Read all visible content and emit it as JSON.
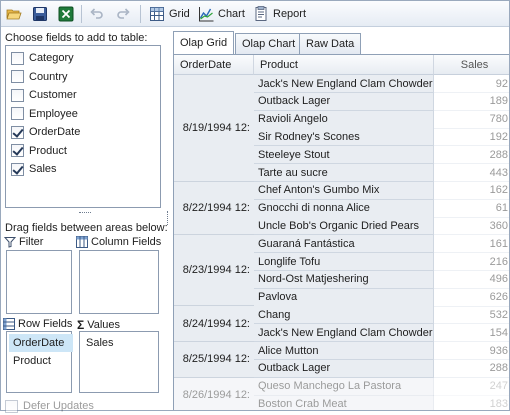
{
  "toolbar": {
    "grid_label": "Grid",
    "chart_label": "Chart",
    "report_label": "Report",
    "icons": [
      "open-folder-icon",
      "save-icon",
      "excel-icon",
      "undo-icon",
      "redo-icon",
      "grid-icon",
      "chart-icon",
      "report-icon"
    ]
  },
  "field_chooser": {
    "title": "Choose fields to add to table:",
    "fields": [
      {
        "label": "Category",
        "checked": false
      },
      {
        "label": "Country",
        "checked": false
      },
      {
        "label": "Customer",
        "checked": false
      },
      {
        "label": "Employee",
        "checked": false
      },
      {
        "label": "OrderDate",
        "checked": true
      },
      {
        "label": "Product",
        "checked": true
      },
      {
        "label": "Sales",
        "checked": true
      }
    ],
    "drag_hint": "Drag fields between areas below:",
    "areas": {
      "filter": {
        "label": "Filter",
        "items": []
      },
      "columns": {
        "label": "Column Fields",
        "items": []
      },
      "rows": {
        "label": "Row Fields",
        "items": [
          "OrderDate",
          "Product"
        ]
      },
      "values": {
        "label": "Values",
        "items": [
          "Sales"
        ]
      }
    },
    "defer_label": "Defer Updates"
  },
  "tabs": [
    "Olap Grid",
    "Olap Chart",
    "Raw Data"
  ],
  "grid": {
    "headers": [
      "OrderDate",
      "Product",
      "Sales"
    ],
    "groups": [
      {
        "date": "8/19/1994 12:",
        "rows": [
          {
            "product": "Jack's New England Clam Chowder",
            "sales": "92"
          },
          {
            "product": "Outback Lager",
            "sales": "189"
          },
          {
            "product": "Ravioli Angelo",
            "sales": "780"
          },
          {
            "product": "Sir Rodney's Scones",
            "sales": "192"
          },
          {
            "product": "Steeleye Stout",
            "sales": "288"
          },
          {
            "product": "Tarte au sucre",
            "sales": "443"
          }
        ]
      },
      {
        "date": "8/22/1994 12:",
        "rows": [
          {
            "product": "Chef Anton's Gumbo Mix",
            "sales": "162"
          },
          {
            "product": "Gnocchi di nonna Alice",
            "sales": "61"
          },
          {
            "product": "Uncle Bob's Organic Dried Pears",
            "sales": "360"
          }
        ]
      },
      {
        "date": "8/23/1994 12:",
        "rows": [
          {
            "product": "Guaraná Fantástica",
            "sales": "161"
          },
          {
            "product": "Longlife Tofu",
            "sales": "216"
          },
          {
            "product": "Nord-Ost Matjeshering",
            "sales": "496"
          },
          {
            "product": "Pavlova",
            "sales": "626"
          }
        ]
      },
      {
        "date": "8/24/1994 12:",
        "rows": [
          {
            "product": "Chang",
            "sales": "532"
          },
          {
            "product": "Jack's New England Clam Chowder",
            "sales": "154"
          }
        ]
      },
      {
        "date": "8/25/1994 12:",
        "rows": [
          {
            "product": "Alice Mutton",
            "sales": "936"
          },
          {
            "product": "Outback Lager",
            "sales": "288"
          }
        ]
      },
      {
        "date": "8/26/1994 12:",
        "rows": [
          {
            "product": "Queso Manchego La Pastora",
            "sales": "247"
          },
          {
            "product": "Boston Crab Meat",
            "sales": "183"
          }
        ]
      }
    ]
  },
  "colors": {
    "accent": "#cde6f7",
    "border": "#8fa0b6",
    "header_bg": "#e9edf2"
  }
}
